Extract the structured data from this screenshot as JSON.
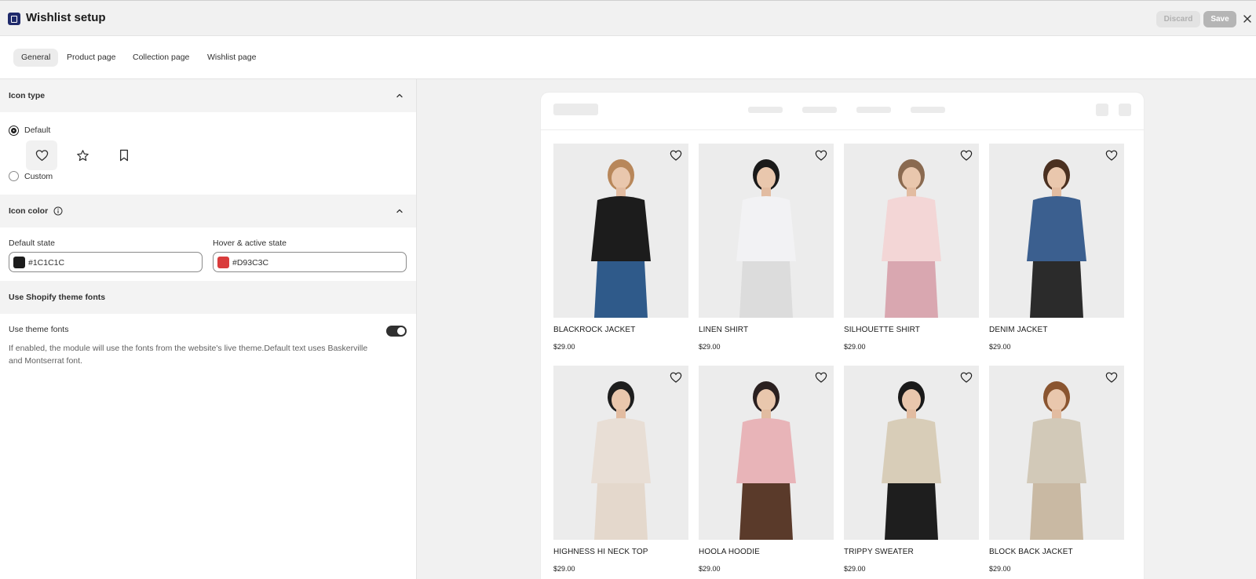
{
  "app": {
    "title": "Wishlist setup",
    "discard_label": "Discard",
    "save_label": "Save"
  },
  "tabs": [
    {
      "label": "General",
      "active": true
    },
    {
      "label": "Product page"
    },
    {
      "label": "Collection page"
    },
    {
      "label": "Wishlist page"
    }
  ],
  "icon_type": {
    "title": "Icon type",
    "default_label": "Default",
    "custom_label": "Custom",
    "selected": "Default",
    "icons": [
      "heart-icon",
      "star-icon",
      "bookmark-icon"
    ]
  },
  "icon_color": {
    "title": "Icon color",
    "default_state_label": "Default state",
    "default_state_value": "#1C1C1C",
    "hover_state_label": "Hover & active state",
    "hover_state_value": "#D93C3C"
  },
  "theme_fonts": {
    "title": "Use Shopify theme fonts",
    "toggle_label": "Use theme fonts",
    "enabled": true,
    "help": "If enabled, the module will use the fonts from the website's live theme.Default text uses Baskerville and Montserrat font."
  },
  "products": [
    {
      "name": "BLACKROCK JACKET",
      "price": "$29.00"
    },
    {
      "name": "LINEN SHIRT",
      "price": "$29.00"
    },
    {
      "name": "SILHOUETTE SHIRT",
      "price": "$29.00"
    },
    {
      "name": "DENIM JACKET",
      "price": "$29.00"
    },
    {
      "name": "HIGHNESS HI NECK TOP",
      "price": "$29.00"
    },
    {
      "name": "HOOLA HOODIE",
      "price": "$29.00"
    },
    {
      "name": "TRIPPY SWEATER",
      "price": "$29.00"
    },
    {
      "name": "BLOCK BACK JACKET",
      "price": "$29.00"
    }
  ]
}
